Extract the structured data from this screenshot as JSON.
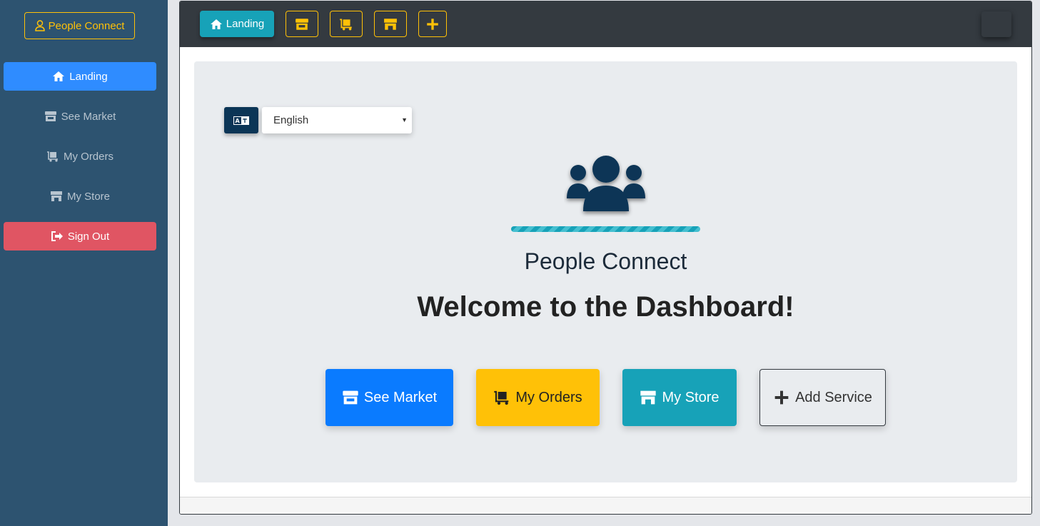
{
  "sidebar": {
    "brand": "People Connect",
    "items": [
      {
        "label": "Landing",
        "icon": "home-icon"
      },
      {
        "label": "See Market",
        "icon": "store-icon"
      },
      {
        "label": "My Orders",
        "icon": "cart-icon"
      },
      {
        "label": "My Store",
        "icon": "shop-icon"
      },
      {
        "label": "Sign Out",
        "icon": "sign-out-icon"
      }
    ]
  },
  "topbar": {
    "landing_label": "Landing",
    "icons": [
      "store-icon",
      "cart-icon",
      "shop-icon",
      "plus-icon"
    ]
  },
  "language": {
    "icon": "translate-icon",
    "selected": "English"
  },
  "hero": {
    "icon": "users-icon",
    "app_name": "People Connect",
    "welcome": "Welcome to the Dashboard!"
  },
  "actions": [
    {
      "label": "See Market",
      "icon": "store-icon"
    },
    {
      "label": "My Orders",
      "icon": "cart-icon"
    },
    {
      "label": "My Store",
      "icon": "shop-icon"
    },
    {
      "label": "Add Service",
      "icon": "plus-icon"
    }
  ],
  "colors": {
    "sidebar_bg": "#2d5370",
    "primary": "#0a7bff",
    "warning": "#ffc107",
    "info": "#17a2b8",
    "danger": "#e05563",
    "dark": "#343a40"
  }
}
